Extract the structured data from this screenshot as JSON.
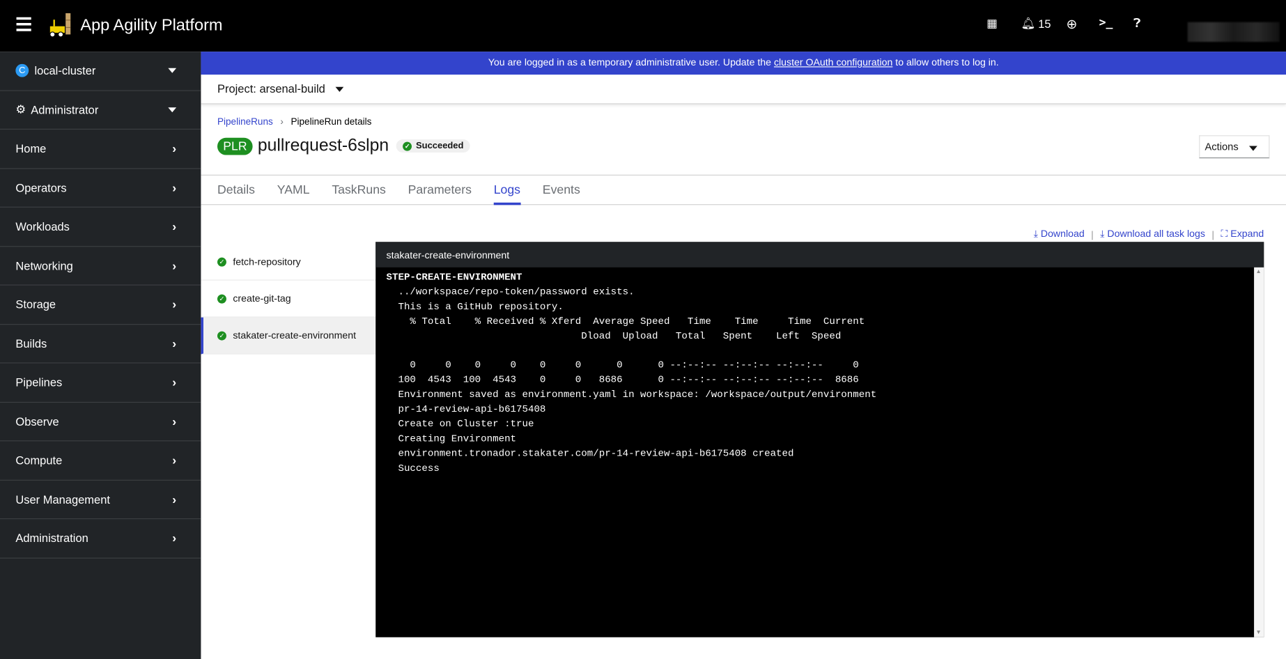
{
  "masthead": {
    "brand": "App Agility Platform",
    "notifications": "15"
  },
  "sidebar": {
    "cluster": "local-cluster",
    "cluster_badge": "C",
    "perspective": "Administrator",
    "items": [
      "Home",
      "Operators",
      "Workloads",
      "Networking",
      "Storage",
      "Builds",
      "Pipelines",
      "Observe",
      "Compute",
      "User Management",
      "Administration"
    ]
  },
  "banner": {
    "before": "You are logged in as a temporary administrative user. Update the ",
    "link": "cluster OAuth configuration",
    "after": " to allow others to log in."
  },
  "project": {
    "label": "Project: arsenal-build"
  },
  "breadcrumb": {
    "parent": "PipelineRuns",
    "current": "PipelineRun details"
  },
  "header": {
    "badge": "PLR",
    "name": "pullrequest-6slpn",
    "status": "Succeeded",
    "actions": "Actions"
  },
  "tabs": [
    "Details",
    "YAML",
    "TaskRuns",
    "Parameters",
    "Logs",
    "Events"
  ],
  "active_tab": "Logs",
  "log_links": {
    "download": "Download",
    "download_all": "Download all task logs",
    "expand": "Expand"
  },
  "tasks": [
    "fetch-repository",
    "create-git-tag",
    "stakater-create-environment"
  ],
  "log": {
    "title": "stakater-create-environment",
    "step": "STEP-CREATE-ENVIRONMENT",
    "lines": [
      "  ../workspace/repo-token/password exists.",
      "  This is a GitHub repository.",
      "    % Total    % Received % Xferd  Average Speed   Time    Time     Time  Current",
      "                                 Dload  Upload   Total   Spent    Left  Speed",
      "",
      "    0     0    0     0    0     0      0      0 --:--:-- --:--:-- --:--:--     0",
      "  100  4543  100  4543    0     0   8686      0 --:--:-- --:--:-- --:--:--  8686",
      "  Environment saved as environment.yaml in workspace: /workspace/output/environment",
      "  pr-14-review-api-b6175408",
      "  Create on Cluster :true",
      "  Creating Environment",
      "  environment.tronador.stakater.com/pr-14-review-api-b6175408 created",
      "  Success"
    ]
  }
}
